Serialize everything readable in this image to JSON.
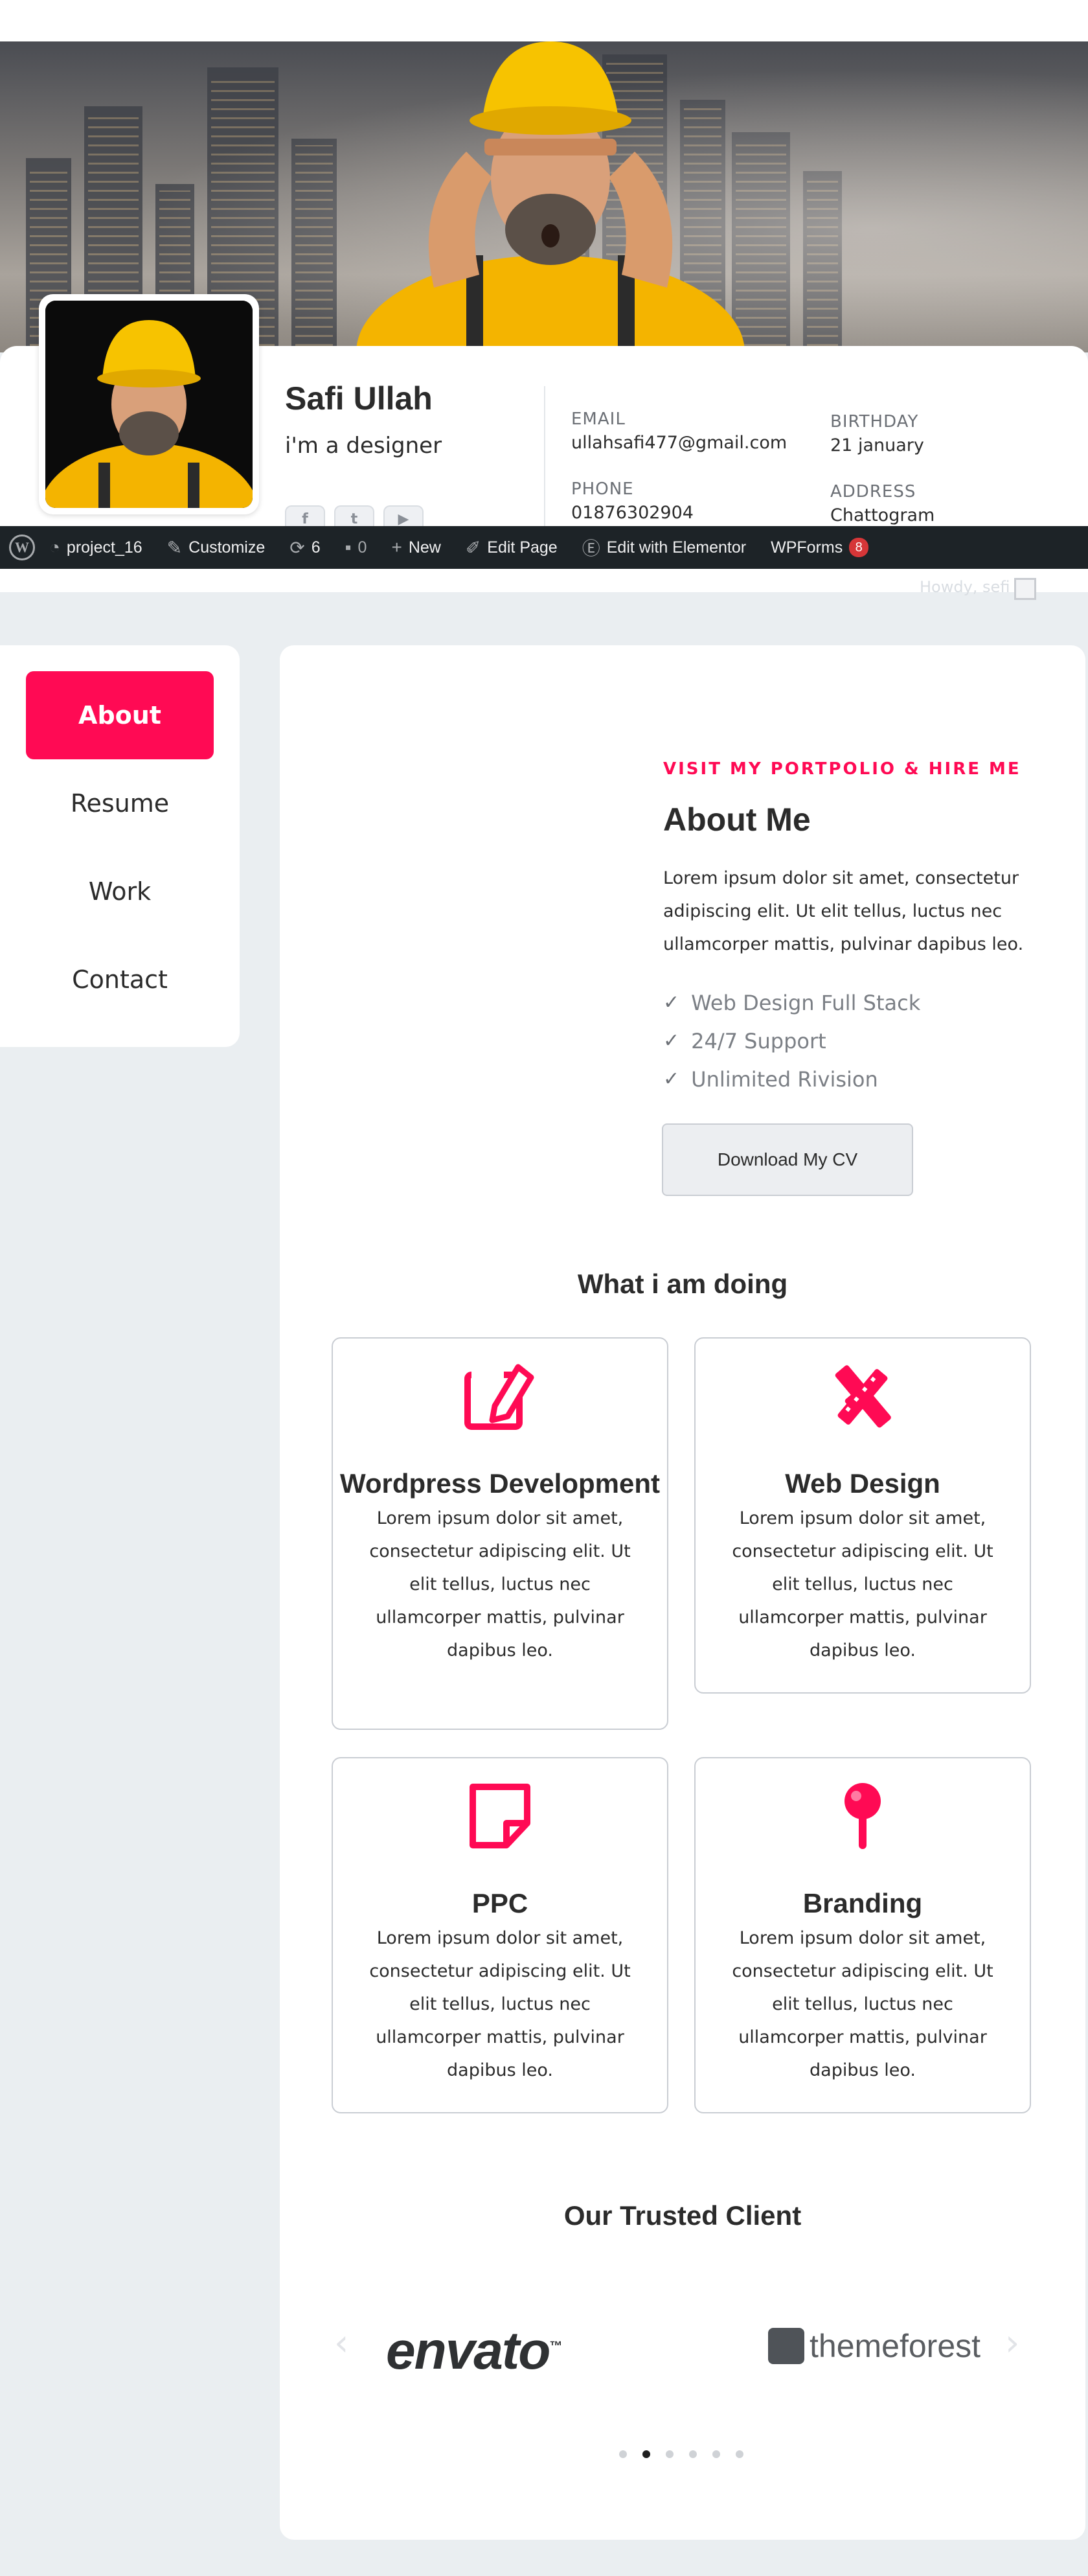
{
  "profile": {
    "name": "Safi Ullah",
    "role": "i'm a designer",
    "email_label": "EMAIL",
    "email": "ullahsafi477@gmail.com",
    "phone_label": "PHONE",
    "phone": "01876302904",
    "birthday_label": "BIRTHDAY",
    "birthday": "21 january",
    "address_label": "ADDRESS",
    "address": "Chattogram",
    "socials": [
      "facebook-icon",
      "twitter-icon",
      "youtube-icon"
    ]
  },
  "adminbar": {
    "site": "project_16",
    "customize": "Customize",
    "updates": "6",
    "comments": "0",
    "new": "New",
    "edit_page": "Edit Page",
    "elementor": "Edit with Elementor",
    "wpforms": "WPForms",
    "wpforms_badge": "8",
    "howdy": "Howdy, sefi"
  },
  "nav": {
    "items": [
      {
        "label": "About",
        "active": true
      },
      {
        "label": "Resume",
        "active": false
      },
      {
        "label": "Work",
        "active": false
      },
      {
        "label": "Contact",
        "active": false
      }
    ]
  },
  "about": {
    "kicker": "VISIT MY PORTPOLIO & HIRE ME",
    "title": "About Me",
    "body": "Lorem ipsum dolor sit amet, consectetur adipiscing elit. Ut elit tellus, luctus nec ullamcorper mattis, pulvinar dapibus leo.",
    "checks": [
      "Web Design Full Stack",
      "24/7 Support",
      "Unlimited Rivision"
    ],
    "cv_button": "Download My CV"
  },
  "services": {
    "title": "What i am doing",
    "items": [
      {
        "title": "Wordpress Development",
        "text": "Lorem ipsum dolor sit amet, consectetur adipiscing elit. Ut elit tellus, luctus nec ullamcorper mattis, pulvinar dapibus leo.",
        "icon": "edit-icon"
      },
      {
        "title": "Web Design",
        "text": "Lorem ipsum dolor sit amet, consectetur adipiscing elit. Ut elit tellus, luctus nec ullamcorper mattis, pulvinar dapibus leo.",
        "icon": "pencil-ruler-icon"
      },
      {
        "title": "PPC",
        "text": "Lorem ipsum dolor sit amet, consectetur adipiscing elit. Ut elit tellus, luctus nec ullamcorper mattis, pulvinar dapibus leo.",
        "icon": "sticky-note-icon"
      },
      {
        "title": "Branding",
        "text": "Lorem ipsum dolor sit amet, consectetur adipiscing elit. Ut elit tellus, luctus nec ullamcorper mattis, pulvinar dapibus leo.",
        "icon": "pin-icon"
      }
    ]
  },
  "clients": {
    "title": "Our Trusted Client",
    "logos": [
      "envato",
      "themeforest"
    ],
    "envato_tm": "™",
    "dots": 6,
    "active_dot": 2
  },
  "colors": {
    "accent": "#ff0a54",
    "background": "#eaeef1",
    "adminbar": "#1d2327"
  }
}
